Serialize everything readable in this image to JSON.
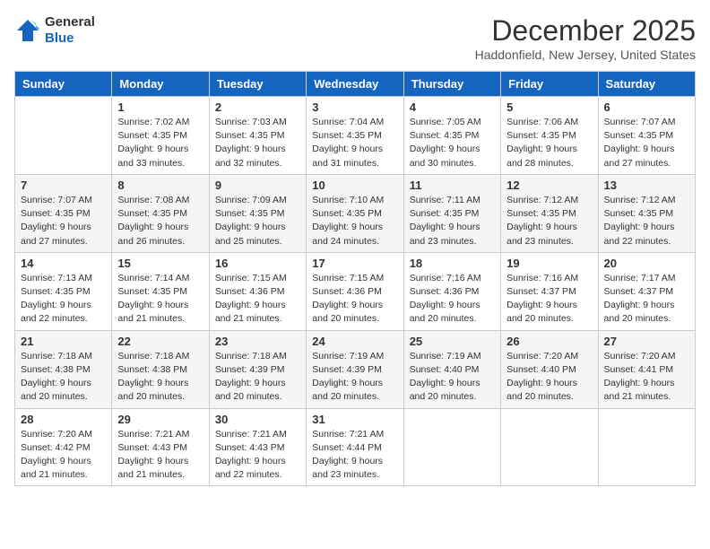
{
  "logo": {
    "line1": "General",
    "line2": "Blue"
  },
  "title": "December 2025",
  "location": "Haddonfield, New Jersey, United States",
  "weekdays": [
    "Sunday",
    "Monday",
    "Tuesday",
    "Wednesday",
    "Thursday",
    "Friday",
    "Saturday"
  ],
  "weeks": [
    [
      {
        "day": "",
        "sunrise": "",
        "sunset": "",
        "daylight": ""
      },
      {
        "day": "1",
        "sunrise": "Sunrise: 7:02 AM",
        "sunset": "Sunset: 4:35 PM",
        "daylight": "Daylight: 9 hours and 33 minutes."
      },
      {
        "day": "2",
        "sunrise": "Sunrise: 7:03 AM",
        "sunset": "Sunset: 4:35 PM",
        "daylight": "Daylight: 9 hours and 32 minutes."
      },
      {
        "day": "3",
        "sunrise": "Sunrise: 7:04 AM",
        "sunset": "Sunset: 4:35 PM",
        "daylight": "Daylight: 9 hours and 31 minutes."
      },
      {
        "day": "4",
        "sunrise": "Sunrise: 7:05 AM",
        "sunset": "Sunset: 4:35 PM",
        "daylight": "Daylight: 9 hours and 30 minutes."
      },
      {
        "day": "5",
        "sunrise": "Sunrise: 7:06 AM",
        "sunset": "Sunset: 4:35 PM",
        "daylight": "Daylight: 9 hours and 28 minutes."
      },
      {
        "day": "6",
        "sunrise": "Sunrise: 7:07 AM",
        "sunset": "Sunset: 4:35 PM",
        "daylight": "Daylight: 9 hours and 27 minutes."
      }
    ],
    [
      {
        "day": "7",
        "sunrise": "Sunrise: 7:07 AM",
        "sunset": "Sunset: 4:35 PM",
        "daylight": "Daylight: 9 hours and 27 minutes."
      },
      {
        "day": "8",
        "sunrise": "Sunrise: 7:08 AM",
        "sunset": "Sunset: 4:35 PM",
        "daylight": "Daylight: 9 hours and 26 minutes."
      },
      {
        "day": "9",
        "sunrise": "Sunrise: 7:09 AM",
        "sunset": "Sunset: 4:35 PM",
        "daylight": "Daylight: 9 hours and 25 minutes."
      },
      {
        "day": "10",
        "sunrise": "Sunrise: 7:10 AM",
        "sunset": "Sunset: 4:35 PM",
        "daylight": "Daylight: 9 hours and 24 minutes."
      },
      {
        "day": "11",
        "sunrise": "Sunrise: 7:11 AM",
        "sunset": "Sunset: 4:35 PM",
        "daylight": "Daylight: 9 hours and 23 minutes."
      },
      {
        "day": "12",
        "sunrise": "Sunrise: 7:12 AM",
        "sunset": "Sunset: 4:35 PM",
        "daylight": "Daylight: 9 hours and 23 minutes."
      },
      {
        "day": "13",
        "sunrise": "Sunrise: 7:12 AM",
        "sunset": "Sunset: 4:35 PM",
        "daylight": "Daylight: 9 hours and 22 minutes."
      }
    ],
    [
      {
        "day": "14",
        "sunrise": "Sunrise: 7:13 AM",
        "sunset": "Sunset: 4:35 PM",
        "daylight": "Daylight: 9 hours and 22 minutes."
      },
      {
        "day": "15",
        "sunrise": "Sunrise: 7:14 AM",
        "sunset": "Sunset: 4:35 PM",
        "daylight": "Daylight: 9 hours and 21 minutes."
      },
      {
        "day": "16",
        "sunrise": "Sunrise: 7:15 AM",
        "sunset": "Sunset: 4:36 PM",
        "daylight": "Daylight: 9 hours and 21 minutes."
      },
      {
        "day": "17",
        "sunrise": "Sunrise: 7:15 AM",
        "sunset": "Sunset: 4:36 PM",
        "daylight": "Daylight: 9 hours and 20 minutes."
      },
      {
        "day": "18",
        "sunrise": "Sunrise: 7:16 AM",
        "sunset": "Sunset: 4:36 PM",
        "daylight": "Daylight: 9 hours and 20 minutes."
      },
      {
        "day": "19",
        "sunrise": "Sunrise: 7:16 AM",
        "sunset": "Sunset: 4:37 PM",
        "daylight": "Daylight: 9 hours and 20 minutes."
      },
      {
        "day": "20",
        "sunrise": "Sunrise: 7:17 AM",
        "sunset": "Sunset: 4:37 PM",
        "daylight": "Daylight: 9 hours and 20 minutes."
      }
    ],
    [
      {
        "day": "21",
        "sunrise": "Sunrise: 7:18 AM",
        "sunset": "Sunset: 4:38 PM",
        "daylight": "Daylight: 9 hours and 20 minutes."
      },
      {
        "day": "22",
        "sunrise": "Sunrise: 7:18 AM",
        "sunset": "Sunset: 4:38 PM",
        "daylight": "Daylight: 9 hours and 20 minutes."
      },
      {
        "day": "23",
        "sunrise": "Sunrise: 7:18 AM",
        "sunset": "Sunset: 4:39 PM",
        "daylight": "Daylight: 9 hours and 20 minutes."
      },
      {
        "day": "24",
        "sunrise": "Sunrise: 7:19 AM",
        "sunset": "Sunset: 4:39 PM",
        "daylight": "Daylight: 9 hours and 20 minutes."
      },
      {
        "day": "25",
        "sunrise": "Sunrise: 7:19 AM",
        "sunset": "Sunset: 4:40 PM",
        "daylight": "Daylight: 9 hours and 20 minutes."
      },
      {
        "day": "26",
        "sunrise": "Sunrise: 7:20 AM",
        "sunset": "Sunset: 4:40 PM",
        "daylight": "Daylight: 9 hours and 20 minutes."
      },
      {
        "day": "27",
        "sunrise": "Sunrise: 7:20 AM",
        "sunset": "Sunset: 4:41 PM",
        "daylight": "Daylight: 9 hours and 21 minutes."
      }
    ],
    [
      {
        "day": "28",
        "sunrise": "Sunrise: 7:20 AM",
        "sunset": "Sunset: 4:42 PM",
        "daylight": "Daylight: 9 hours and 21 minutes."
      },
      {
        "day": "29",
        "sunrise": "Sunrise: 7:21 AM",
        "sunset": "Sunset: 4:43 PM",
        "daylight": "Daylight: 9 hours and 21 minutes."
      },
      {
        "day": "30",
        "sunrise": "Sunrise: 7:21 AM",
        "sunset": "Sunset: 4:43 PM",
        "daylight": "Daylight: 9 hours and 22 minutes."
      },
      {
        "day": "31",
        "sunrise": "Sunrise: 7:21 AM",
        "sunset": "Sunset: 4:44 PM",
        "daylight": "Daylight: 9 hours and 23 minutes."
      },
      {
        "day": "",
        "sunrise": "",
        "sunset": "",
        "daylight": ""
      },
      {
        "day": "",
        "sunrise": "",
        "sunset": "",
        "daylight": ""
      },
      {
        "day": "",
        "sunrise": "",
        "sunset": "",
        "daylight": ""
      }
    ]
  ]
}
